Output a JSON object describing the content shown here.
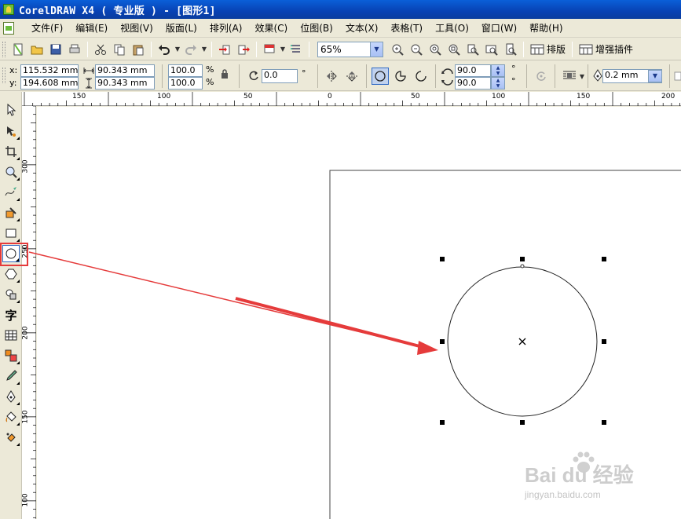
{
  "window": {
    "title": "CorelDRAW X4 ( 专业版 ) - [图形1]",
    "app_icon": "coreldraw-app-icon",
    "doc_icon": "document-icon"
  },
  "menu": [
    "文件(F)",
    "编辑(E)",
    "视图(V)",
    "版面(L)",
    "排列(A)",
    "效果(C)",
    "位图(B)",
    "文本(X)",
    "表格(T)",
    "工具(O)",
    "窗口(W)",
    "帮助(H)"
  ],
  "standard_toolbar": {
    "zoom_level": "65%",
    "layout_label": "排版",
    "plugin_label": "增强插件"
  },
  "property_bar": {
    "x_label": "x:",
    "y_label": "y:",
    "x_value": "115.532 mm",
    "y_value": "194.608 mm",
    "width_value": "90.343 mm",
    "height_value": "90.343 mm",
    "scale_x": "100.0",
    "scale_y": "100.0",
    "percent": "%",
    "rotation": "0.0",
    "degree": "°",
    "start_angle": "90.0",
    "end_angle": "90.0",
    "outline_width": "0.2 mm"
  },
  "rulers": {
    "horizontal_labels": [
      "150",
      "100",
      "50",
      "0",
      "50",
      "100",
      "150",
      "200"
    ],
    "vertical_labels": [
      "300",
      "250",
      "200",
      "150",
      "100"
    ]
  },
  "toolbox": {
    "tools": [
      "pick-tool-icon",
      "shape-tool-icon",
      "crop-tool-icon",
      "zoom-tool-icon",
      "freehand-tool-icon",
      "smart-fill-tool-icon",
      "rectangle-tool-icon",
      "ellipse-tool-icon",
      "polygon-tool-icon",
      "basic-shapes-tool-icon",
      "text-tool-icon",
      "table-tool-icon",
      "interactive-blend-tool-icon",
      "eyedropper-tool-icon",
      "outline-tool-icon",
      "fill-tool-icon",
      "interactive-fill-tool-icon"
    ],
    "text_tool_glyph": "字",
    "selected_tool": "ellipse-tool-icon"
  },
  "colors": {
    "title_bar": "#0842b4",
    "highlight": "#e53b3b",
    "arrow": "#e53b3b",
    "handle": "#000000"
  },
  "watermark": {
    "brand": "Bai du 经验",
    "url": "jingyan.baidu.com"
  }
}
